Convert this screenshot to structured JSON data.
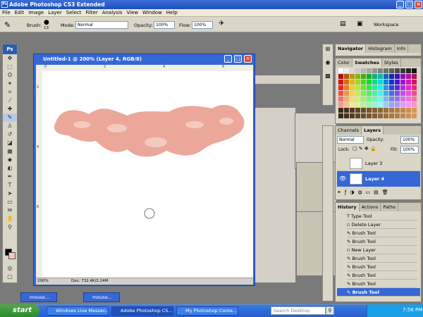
{
  "app": {
    "title": "Adobe Photoshop CS3 Extended",
    "icon_label": "Ps"
  },
  "menu": [
    "File",
    "Edit",
    "Image",
    "Layer",
    "Select",
    "Filter",
    "Analysis",
    "View",
    "Window",
    "Help"
  ],
  "options": {
    "brush_label": "Brush:",
    "brush_size": "13",
    "mode_label": "Mode:",
    "mode_value": "Normal",
    "opacity_label": "Opacity:",
    "opacity_value": "100%",
    "flow_label": "Flow:",
    "flow_value": "100%",
    "workspace_label": "Workspace"
  },
  "toolbox": {
    "logo": "Ps"
  },
  "document": {
    "title": "Untitled-1 @ 200% (Layer 4, RGB/8)",
    "zoom": "200%",
    "status": "Doc: 732.4K/2.24M",
    "ruler_marks": [
      "0",
      "2",
      "4",
      "6"
    ]
  },
  "navigator": {
    "tabs": [
      "Navigator",
      "Histogram",
      "Info"
    ]
  },
  "swatches": {
    "tabs": [
      "Color",
      "Swatches",
      "Styles"
    ]
  },
  "layers": {
    "tabs": [
      "Channels",
      "Layers"
    ],
    "mode": "Normal",
    "opacity_label": "Opacity:",
    "opacity": "100%",
    "lock_label": "Lock:",
    "fill_label": "Fill:",
    "fill": "100%",
    "items": [
      "Layer 3",
      "Layer 4"
    ]
  },
  "history": {
    "tabs": [
      "History",
      "Actions",
      "Paths"
    ],
    "items": [
      "Type Tool",
      "Delete Layer",
      "Brush Tool",
      "Brush Tool",
      "New Layer",
      "Brush Tool",
      "Brush Tool",
      "Brush Tool",
      "Brush Tool",
      "Brush Tool"
    ]
  },
  "taskbar": {
    "start": "start",
    "tasks": [
      "Windows Live Messen...",
      "Adobe Photoshop CS...",
      "My Photoshop Conte..."
    ],
    "mini_tasks": [
      "mouse...",
      "mouse..."
    ],
    "search": "Search Desktop",
    "clock": "7:56 PM"
  },
  "colors": {
    "accent": "#3568d6",
    "stroke_pink": "#eba89a",
    "stroke_light": "#f4cac0"
  }
}
